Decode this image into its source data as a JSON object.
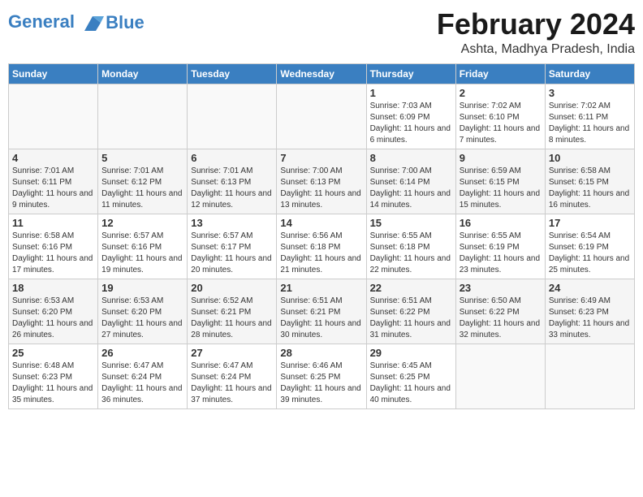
{
  "header": {
    "logo_line1": "General",
    "logo_line2": "Blue",
    "month_year": "February 2024",
    "location": "Ashta, Madhya Pradesh, India"
  },
  "days_of_week": [
    "Sunday",
    "Monday",
    "Tuesday",
    "Wednesday",
    "Thursday",
    "Friday",
    "Saturday"
  ],
  "weeks": [
    [
      {
        "day": "",
        "info": ""
      },
      {
        "day": "",
        "info": ""
      },
      {
        "day": "",
        "info": ""
      },
      {
        "day": "",
        "info": ""
      },
      {
        "day": "1",
        "info": "Sunrise: 7:03 AM\nSunset: 6:09 PM\nDaylight: 11 hours and 6 minutes."
      },
      {
        "day": "2",
        "info": "Sunrise: 7:02 AM\nSunset: 6:10 PM\nDaylight: 11 hours and 7 minutes."
      },
      {
        "day": "3",
        "info": "Sunrise: 7:02 AM\nSunset: 6:11 PM\nDaylight: 11 hours and 8 minutes."
      }
    ],
    [
      {
        "day": "4",
        "info": "Sunrise: 7:01 AM\nSunset: 6:11 PM\nDaylight: 11 hours and 9 minutes."
      },
      {
        "day": "5",
        "info": "Sunrise: 7:01 AM\nSunset: 6:12 PM\nDaylight: 11 hours and 11 minutes."
      },
      {
        "day": "6",
        "info": "Sunrise: 7:01 AM\nSunset: 6:13 PM\nDaylight: 11 hours and 12 minutes."
      },
      {
        "day": "7",
        "info": "Sunrise: 7:00 AM\nSunset: 6:13 PM\nDaylight: 11 hours and 13 minutes."
      },
      {
        "day": "8",
        "info": "Sunrise: 7:00 AM\nSunset: 6:14 PM\nDaylight: 11 hours and 14 minutes."
      },
      {
        "day": "9",
        "info": "Sunrise: 6:59 AM\nSunset: 6:15 PM\nDaylight: 11 hours and 15 minutes."
      },
      {
        "day": "10",
        "info": "Sunrise: 6:58 AM\nSunset: 6:15 PM\nDaylight: 11 hours and 16 minutes."
      }
    ],
    [
      {
        "day": "11",
        "info": "Sunrise: 6:58 AM\nSunset: 6:16 PM\nDaylight: 11 hours and 17 minutes."
      },
      {
        "day": "12",
        "info": "Sunrise: 6:57 AM\nSunset: 6:16 PM\nDaylight: 11 hours and 19 minutes."
      },
      {
        "day": "13",
        "info": "Sunrise: 6:57 AM\nSunset: 6:17 PM\nDaylight: 11 hours and 20 minutes."
      },
      {
        "day": "14",
        "info": "Sunrise: 6:56 AM\nSunset: 6:18 PM\nDaylight: 11 hours and 21 minutes."
      },
      {
        "day": "15",
        "info": "Sunrise: 6:55 AM\nSunset: 6:18 PM\nDaylight: 11 hours and 22 minutes."
      },
      {
        "day": "16",
        "info": "Sunrise: 6:55 AM\nSunset: 6:19 PM\nDaylight: 11 hours and 23 minutes."
      },
      {
        "day": "17",
        "info": "Sunrise: 6:54 AM\nSunset: 6:19 PM\nDaylight: 11 hours and 25 minutes."
      }
    ],
    [
      {
        "day": "18",
        "info": "Sunrise: 6:53 AM\nSunset: 6:20 PM\nDaylight: 11 hours and 26 minutes."
      },
      {
        "day": "19",
        "info": "Sunrise: 6:53 AM\nSunset: 6:20 PM\nDaylight: 11 hours and 27 minutes."
      },
      {
        "day": "20",
        "info": "Sunrise: 6:52 AM\nSunset: 6:21 PM\nDaylight: 11 hours and 28 minutes."
      },
      {
        "day": "21",
        "info": "Sunrise: 6:51 AM\nSunset: 6:21 PM\nDaylight: 11 hours and 30 minutes."
      },
      {
        "day": "22",
        "info": "Sunrise: 6:51 AM\nSunset: 6:22 PM\nDaylight: 11 hours and 31 minutes."
      },
      {
        "day": "23",
        "info": "Sunrise: 6:50 AM\nSunset: 6:22 PM\nDaylight: 11 hours and 32 minutes."
      },
      {
        "day": "24",
        "info": "Sunrise: 6:49 AM\nSunset: 6:23 PM\nDaylight: 11 hours and 33 minutes."
      }
    ],
    [
      {
        "day": "25",
        "info": "Sunrise: 6:48 AM\nSunset: 6:23 PM\nDaylight: 11 hours and 35 minutes."
      },
      {
        "day": "26",
        "info": "Sunrise: 6:47 AM\nSunset: 6:24 PM\nDaylight: 11 hours and 36 minutes."
      },
      {
        "day": "27",
        "info": "Sunrise: 6:47 AM\nSunset: 6:24 PM\nDaylight: 11 hours and 37 minutes."
      },
      {
        "day": "28",
        "info": "Sunrise: 6:46 AM\nSunset: 6:25 PM\nDaylight: 11 hours and 39 minutes."
      },
      {
        "day": "29",
        "info": "Sunrise: 6:45 AM\nSunset: 6:25 PM\nDaylight: 11 hours and 40 minutes."
      },
      {
        "day": "",
        "info": ""
      },
      {
        "day": "",
        "info": ""
      }
    ]
  ]
}
